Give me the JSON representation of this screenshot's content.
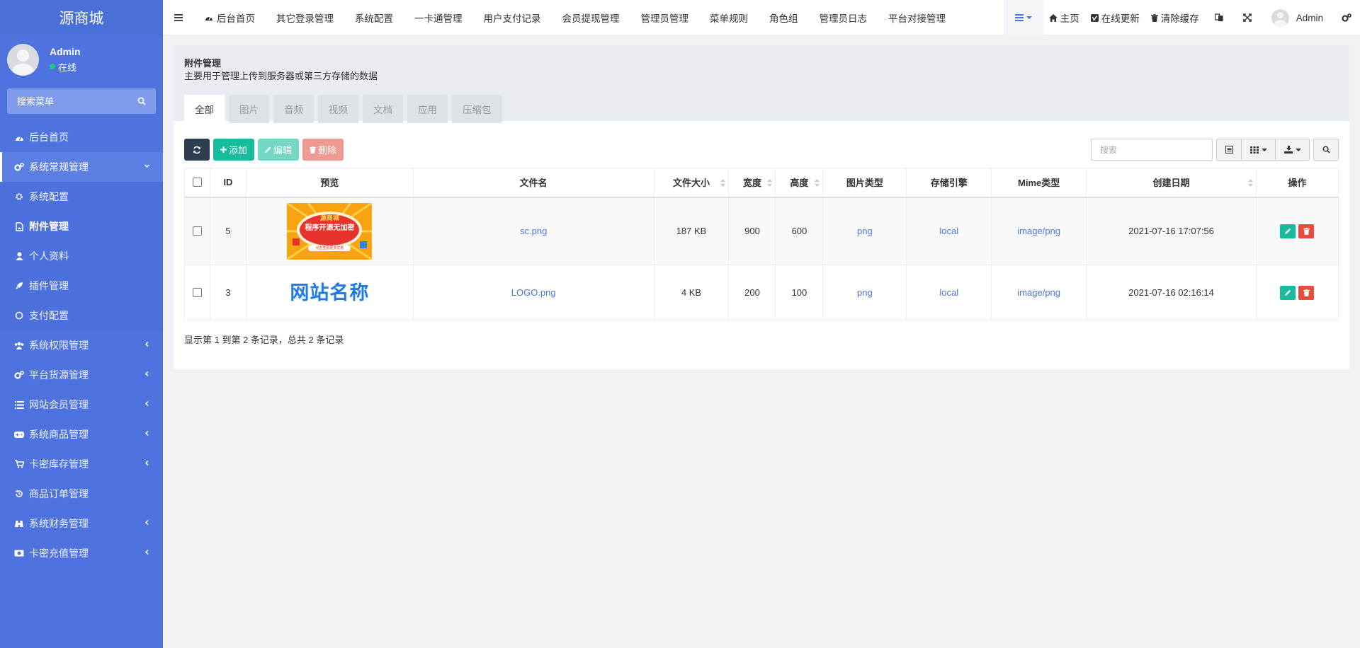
{
  "sidebar": {
    "brand": "源商城",
    "user": {
      "name": "Admin",
      "status": "在线"
    },
    "search_placeholder": "搜索菜单",
    "items": [
      {
        "label": "后台首页",
        "icon": "dashboard-icon"
      },
      {
        "label": "系统常规管理",
        "icon": "cogs-icon"
      },
      {
        "label": "系统配置",
        "icon": "cog-icon"
      },
      {
        "label": "附件管理",
        "icon": "file-image-icon"
      },
      {
        "label": "个人资料",
        "icon": "user-icon"
      },
      {
        "label": "插件管理",
        "icon": "rocket-icon"
      },
      {
        "label": "支付配置",
        "icon": "circle-icon"
      },
      {
        "label": "系统权限管理",
        "icon": "group-icon"
      },
      {
        "label": "平台货源管理",
        "icon": "cogs-icon"
      },
      {
        "label": "网站会员管理",
        "icon": "list-icon"
      },
      {
        "label": "系统商品管理",
        "icon": "gamepad-icon"
      },
      {
        "label": "卡密库存管理",
        "icon": "cart-icon"
      },
      {
        "label": "商品订单管理",
        "icon": "history-icon"
      },
      {
        "label": "系统财务管理",
        "icon": "binoculars-icon"
      },
      {
        "label": "卡密充值管理",
        "icon": "money-icon"
      }
    ]
  },
  "topbar": {
    "tabs": [
      "后台首页",
      "其它登录管理",
      "系统配置",
      "一卡通管理",
      "用户支付记录",
      "会员提现管理",
      "管理员管理",
      "菜单规则",
      "角色组",
      "管理员日志",
      "平台对接管理"
    ],
    "home": "主页",
    "update": "在线更新",
    "clear_cache": "清除缓存",
    "admin": "Admin"
  },
  "panel": {
    "title": "附件管理",
    "description": "主要用于管理上传到服务器或第三方存储的数据",
    "tabs": [
      "全部",
      "图片",
      "音频",
      "视频",
      "文档",
      "应用",
      "压缩包"
    ]
  },
  "toolbar": {
    "add": "添加",
    "edit": "编辑",
    "delete": "删除",
    "search_placeholder": "搜索"
  },
  "table": {
    "headers": [
      "ID",
      "预览",
      "文件名",
      "文件大小",
      "宽度",
      "高度",
      "图片类型",
      "存储引擎",
      "Mime类型",
      "创建日期",
      "操作"
    ],
    "rows": [
      {
        "id": "5",
        "preview_text": [
          "源商城",
          "程序开源无加密",
          "点击查看更多优惠"
        ],
        "filename": "sc.png",
        "size": "187 KB",
        "width": "900",
        "height": "600",
        "imagetype": "png",
        "storage": "local",
        "mimetype": "image/png",
        "createtime": "2021-07-16 17:07:56"
      },
      {
        "id": "3",
        "preview_text": [
          "网站名称"
        ],
        "filename": "LOGO.png",
        "size": "4 KB",
        "width": "200",
        "height": "100",
        "imagetype": "png",
        "storage": "local",
        "mimetype": "image/png",
        "createtime": "2021-07-16 02:16:14"
      }
    ]
  },
  "pagination": "显示第 1 到第 2 条记录，总共 2 条记录",
  "colors": {
    "sidebar": "#4e73df",
    "success": "#18bc9c",
    "danger": "#e74c3c",
    "dark": "#2c3e50",
    "link": "#4e73df"
  }
}
